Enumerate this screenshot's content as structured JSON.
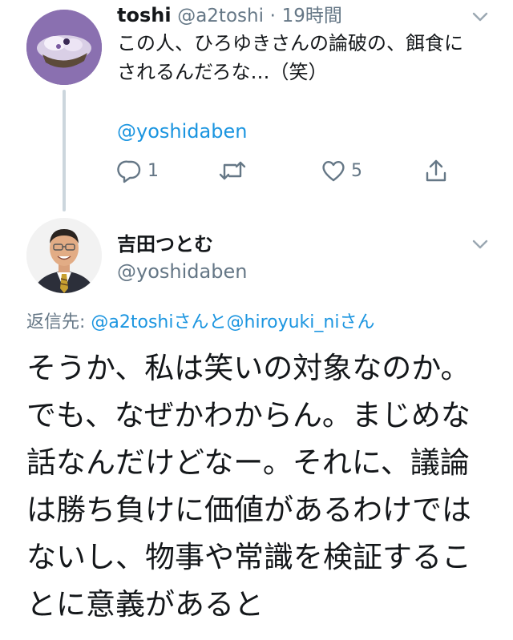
{
  "tweet1": {
    "name": "toshi",
    "handle": "@a2toshi",
    "separator": "·",
    "time": "19時間",
    "text": "この人、ひろゆきさんの論破の、餌食にされるんだろな…（笑）",
    "mention": "@yoshidaben",
    "actions": {
      "reply_icon": "reply-icon",
      "reply_count": "1",
      "retweet_icon": "retweet-icon",
      "like_icon": "heart-icon",
      "like_count": "5",
      "share_icon": "share-icon"
    }
  },
  "tweet2": {
    "name": "吉田つとむ",
    "handle": "@yoshidaben",
    "reply_prefix": "返信先: ",
    "reply_user1": "@a2toshi",
    "reply_conj": "さんと",
    "reply_user2": "@hiroyuki_ni",
    "reply_suffix": "さん",
    "text": "そうか、私は笑いの対象なのか。でも、なぜかわからん。まじめな話なんだけどなー。それに、議論は勝ち負けに価値があるわけではないし、物事や常識を検証することに意義があると"
  },
  "colors": {
    "link": "#1b95e0",
    "muted": "#657786",
    "text": "#14171a",
    "thread_line": "#ccd6dd"
  }
}
